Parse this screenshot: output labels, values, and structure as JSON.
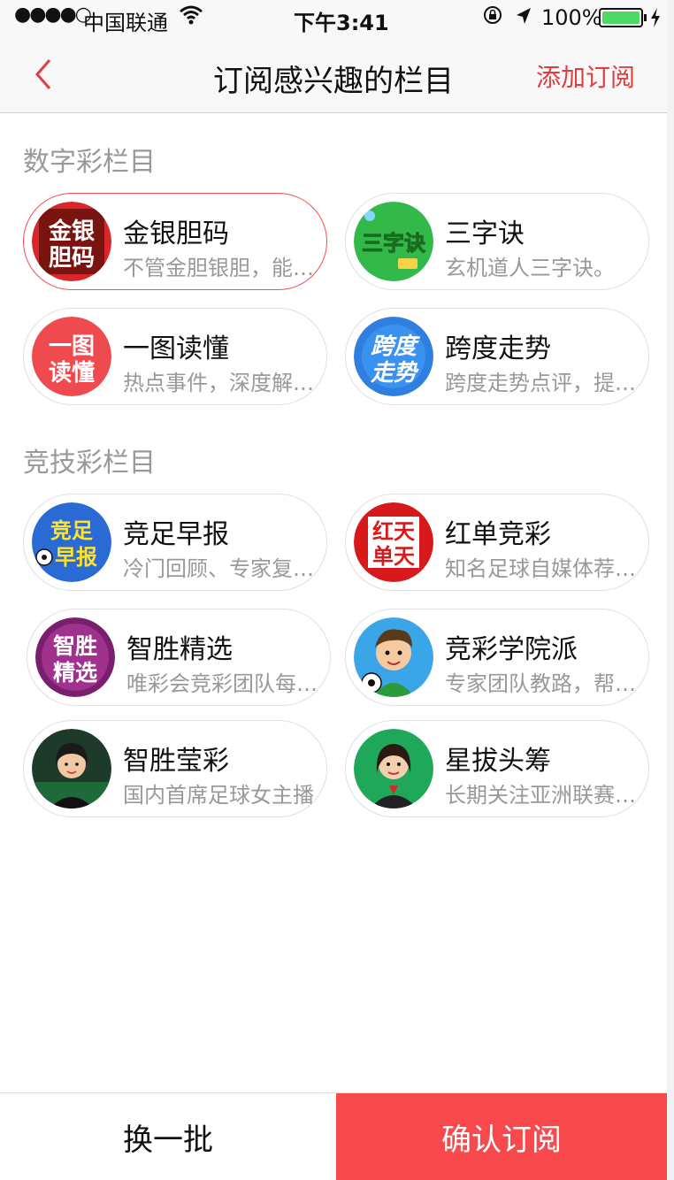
{
  "status_bar": {
    "signal_dots": "●●●●○",
    "carrier": "中国联通",
    "time": "下午3:41",
    "battery_pct": "100%",
    "battery_level": 1.0,
    "icons": [
      "wifi-icon",
      "rotation-lock-icon",
      "location-arrow-icon",
      "battery-icon",
      "charging-bolt-icon"
    ]
  },
  "nav": {
    "back_icon": "chevron-left-icon",
    "title": "订阅感兴趣的栏目",
    "add_label": "添加订阅"
  },
  "colors": {
    "accent": "#e03e3e",
    "primary_text": "#111111",
    "secondary_text": "#999999",
    "card_border": "#dfdfdf",
    "card_selected_border": "#f54c57",
    "confirm_bg": "#f8494c"
  },
  "sections": [
    {
      "title": "数字彩栏目",
      "items": [
        {
          "name": "金银胆码",
          "desc": "不管金胆银胆，能中奖就是好胆",
          "selected": true,
          "avatar_text": [
            "金银",
            "胆码"
          ]
        },
        {
          "name": "三字诀",
          "desc": "玄机道人三字诀。",
          "selected": false,
          "avatar_text": [
            "三字诀"
          ]
        },
        {
          "name": "一图读懂",
          "desc": "热点事件，深度解读一图看懂",
          "selected": false,
          "avatar_text": [
            "一图",
            "读懂"
          ]
        },
        {
          "name": "跨度走势",
          "desc": "跨度走势点评，提供参考",
          "selected": false,
          "avatar_text": [
            "跨度",
            "走势"
          ]
        }
      ]
    },
    {
      "title": "竞技彩栏目",
      "items": [
        {
          "name": "竞足早报",
          "desc": "冷门回顾、专家复盘一网打尽",
          "selected": false,
          "avatar_text": [
            "竞足",
            "早报"
          ]
        },
        {
          "name": "红单竞彩",
          "desc": "知名足球自媒体荐单合集",
          "selected": false,
          "avatar_text": [
            "红天",
            "单天"
          ]
        },
        {
          "name": "智胜精选",
          "desc": "唯彩会竞彩团队每日精选",
          "selected": false,
          "avatar_text": [
            "智胜",
            "精选"
          ]
        },
        {
          "name": "竞彩学院派",
          "desc": "专家团队教路，帮你赢球",
          "selected": false,
          "avatar_text": []
        },
        {
          "name": "智胜莹彩",
          "desc": "国内首席足球女主播",
          "selected": false,
          "avatar_text": []
        },
        {
          "name": "星拔头筹",
          "desc": "长期关注亚洲联赛的专家",
          "selected": false,
          "avatar_text": []
        }
      ]
    }
  ],
  "bottom": {
    "refresh_label": "换一批",
    "confirm_label": "确认订阅"
  }
}
